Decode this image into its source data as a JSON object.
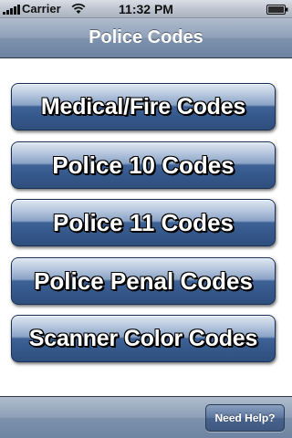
{
  "status_bar": {
    "carrier": "Carrier",
    "time": "11:32 PM",
    "signal_icon": "signal-bars-icon",
    "wifi_icon": "wifi-icon",
    "battery_icon": "battery-icon"
  },
  "nav_bar": {
    "title": "Police Codes"
  },
  "menu": {
    "items": [
      {
        "label": "Medical/Fire Codes"
      },
      {
        "label": "Police 10 Codes"
      },
      {
        "label": "Police 11 Codes"
      },
      {
        "label": "Police Penal Codes"
      },
      {
        "label": "Scanner Color Codes"
      }
    ]
  },
  "toolbar": {
    "help_label": "Need Help?"
  },
  "colors": {
    "bar_blue": "#7d92ad",
    "button_blue": "#35598c",
    "button_text": "#ffffff"
  }
}
